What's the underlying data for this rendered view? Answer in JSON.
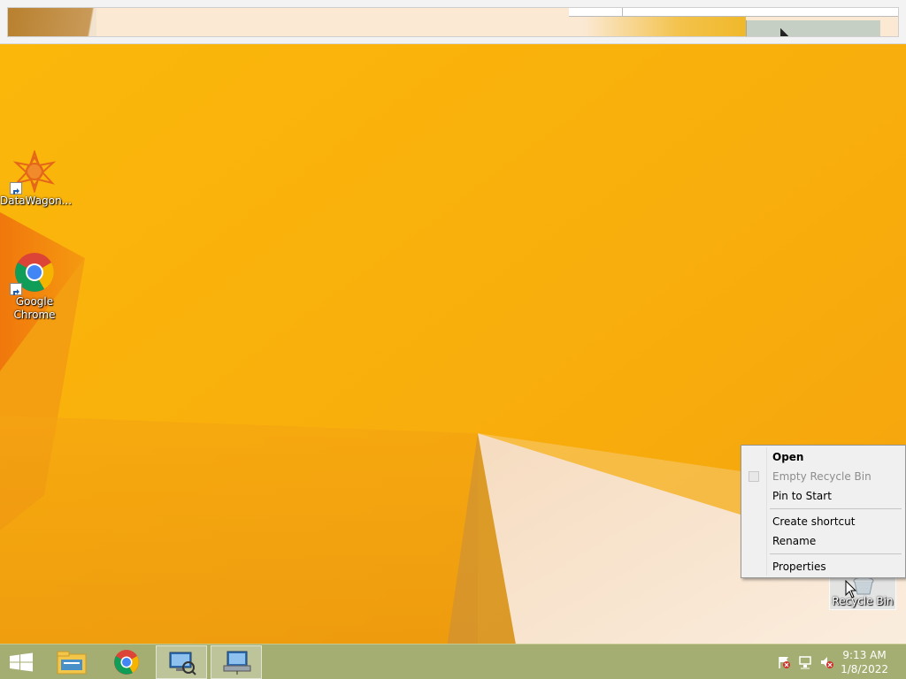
{
  "desktop": {
    "icons": [
      {
        "label": "DataWagon..."
      },
      {
        "label": "Google Chrome"
      }
    ],
    "recycle_bin_label": "Recycle Bin"
  },
  "context_menu": {
    "items": [
      {
        "label": "Open",
        "style": "bold"
      },
      {
        "label": "Empty Recycle Bin",
        "style": "disabled"
      },
      {
        "label": "Pin to Start",
        "style": "normal"
      },
      {
        "label": "Create shortcut",
        "style": "normal"
      },
      {
        "label": "Rename",
        "style": "normal"
      },
      {
        "label": "Properties",
        "style": "normal"
      }
    ]
  },
  "taskbar": {
    "buttons": [
      {
        "icon": "windows-logo-icon"
      },
      {
        "icon": "file-explorer-icon"
      },
      {
        "icon": "chrome-icon"
      },
      {
        "icon": "computer-search-icon"
      },
      {
        "icon": "network-computer-icon"
      }
    ],
    "tray": {
      "icons": [
        "action-center-flag-icon",
        "network-icon",
        "volume-muted-icon"
      ],
      "time": "9:13 AM",
      "date": "1/8/2022"
    }
  },
  "colors": {
    "wallpaper": "#f9b40b",
    "taskbar": "#a4ad72",
    "menu_bg": "#f0f0f0"
  }
}
